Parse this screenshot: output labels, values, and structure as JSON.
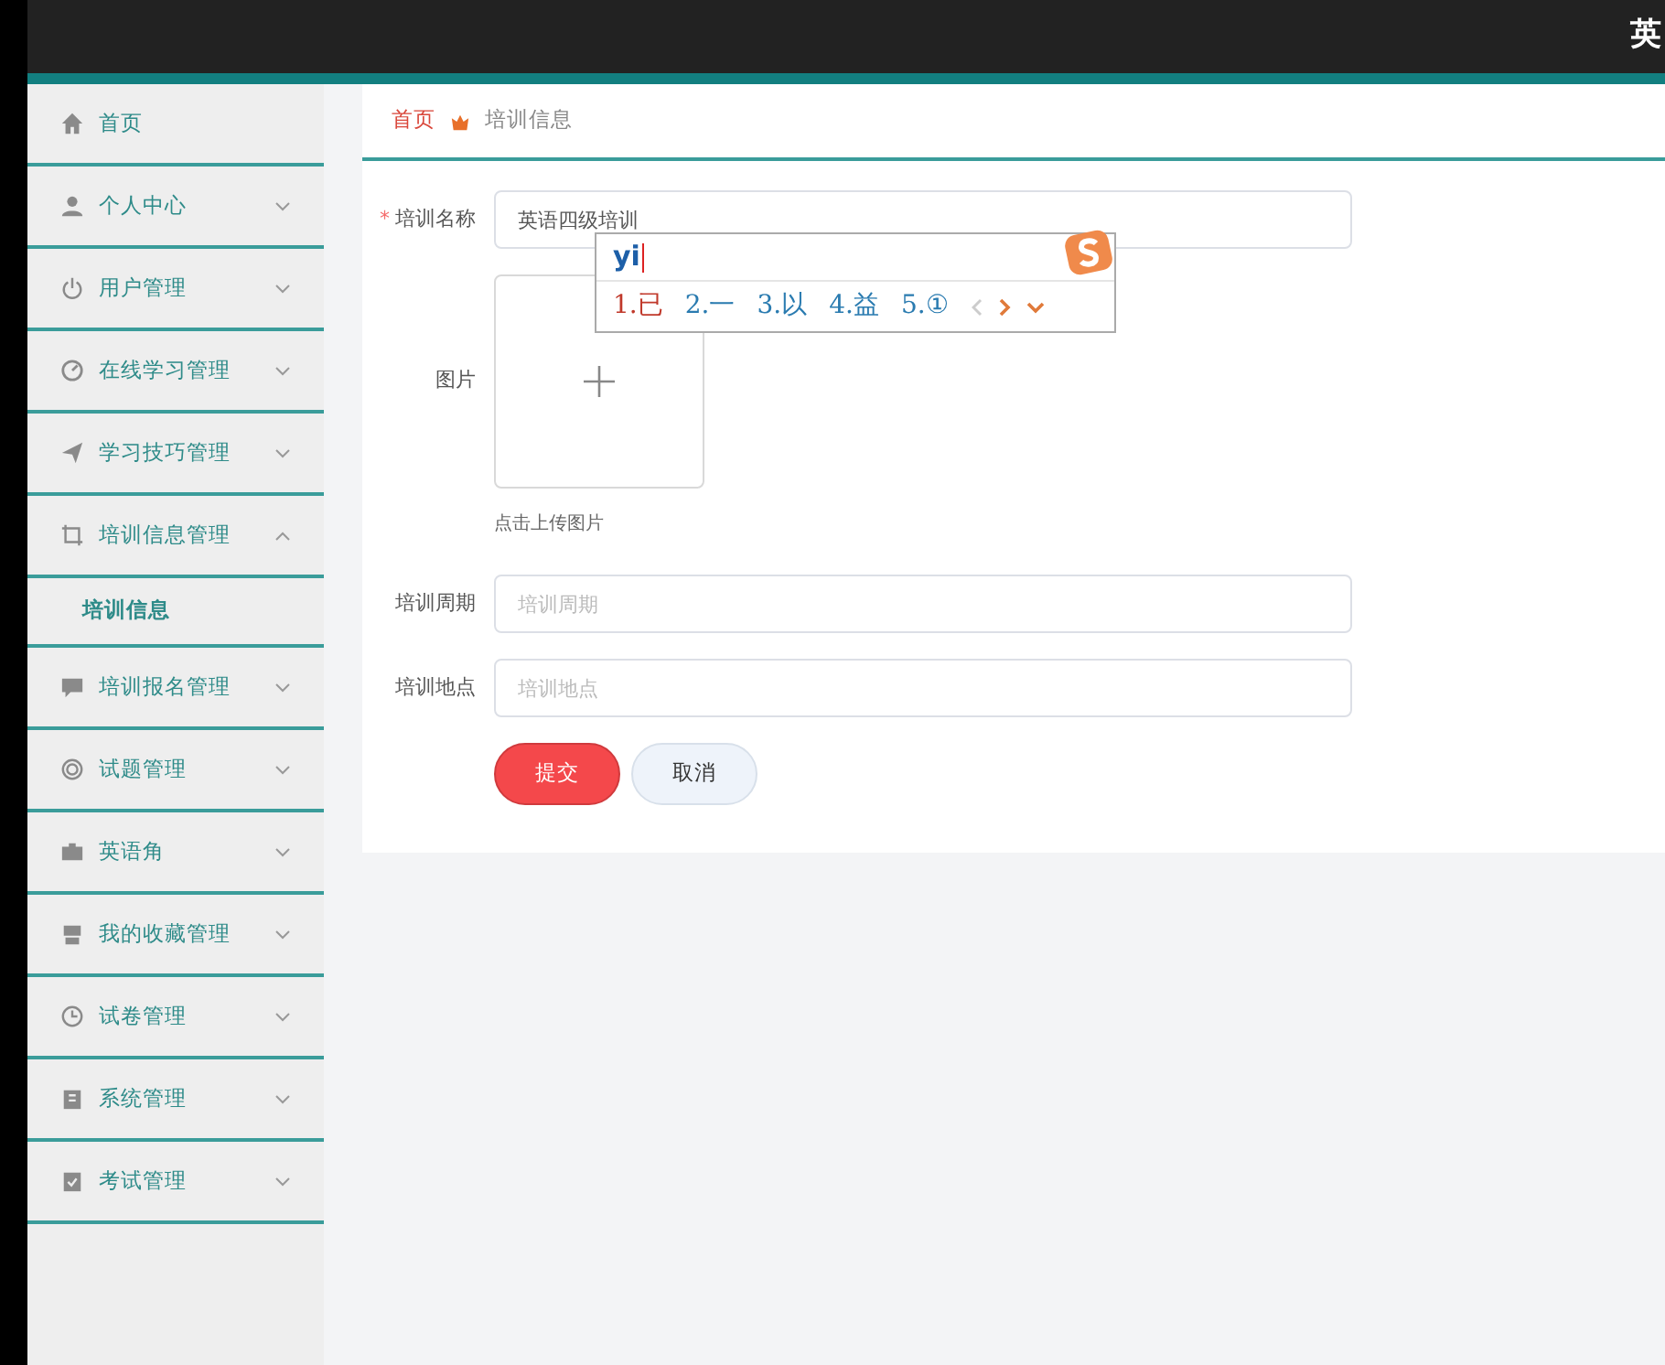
{
  "header": {
    "title": "英"
  },
  "sidebar": {
    "items": [
      {
        "label": "首页",
        "kind": "link"
      },
      {
        "label": "个人中心",
        "kind": "menu",
        "expanded": false
      },
      {
        "label": "用户管理",
        "kind": "menu",
        "expanded": false
      },
      {
        "label": "在线学习管理",
        "kind": "menu",
        "expanded": false
      },
      {
        "label": "学习技巧管理",
        "kind": "menu",
        "expanded": false
      },
      {
        "label": "培训信息管理",
        "kind": "menu",
        "expanded": true,
        "children": [
          {
            "label": "培训信息",
            "selected": true
          }
        ]
      },
      {
        "label": "培训报名管理",
        "kind": "menu",
        "expanded": false
      },
      {
        "label": "试题管理",
        "kind": "menu",
        "expanded": false
      },
      {
        "label": "英语角",
        "kind": "menu",
        "expanded": false
      },
      {
        "label": "我的收藏管理",
        "kind": "menu",
        "expanded": false
      },
      {
        "label": "试卷管理",
        "kind": "menu",
        "expanded": false
      },
      {
        "label": "系统管理",
        "kind": "menu",
        "expanded": false
      },
      {
        "label": "考试管理",
        "kind": "menu",
        "expanded": false
      }
    ]
  },
  "breadcrumb": [
    {
      "label": "首页"
    },
    {
      "label": "培训信息"
    }
  ],
  "form": {
    "fields": [
      {
        "kind": "text",
        "label": "培训名称",
        "required_mark": "*",
        "value": "英语四级培训"
      },
      {
        "kind": "upload",
        "label": "图片",
        "hint": "点击上传图片"
      },
      {
        "kind": "text",
        "label": "培训周期",
        "placeholder": "培训周期"
      },
      {
        "kind": "text",
        "label": "培训地点",
        "placeholder": "培训地点"
      }
    ],
    "buttons": [
      {
        "kind": "primary",
        "label": "提交"
      },
      {
        "kind": "secondary",
        "label": "取消"
      }
    ]
  },
  "ime": {
    "composition": "yi",
    "candidates": [
      {
        "label": "1.已",
        "selected": true
      },
      {
        "label": "2.一",
        "selected": false
      },
      {
        "label": "3.以",
        "selected": false
      },
      {
        "label": "4.益",
        "selected": false
      },
      {
        "label": "5.①",
        "selected": false
      }
    ]
  }
}
